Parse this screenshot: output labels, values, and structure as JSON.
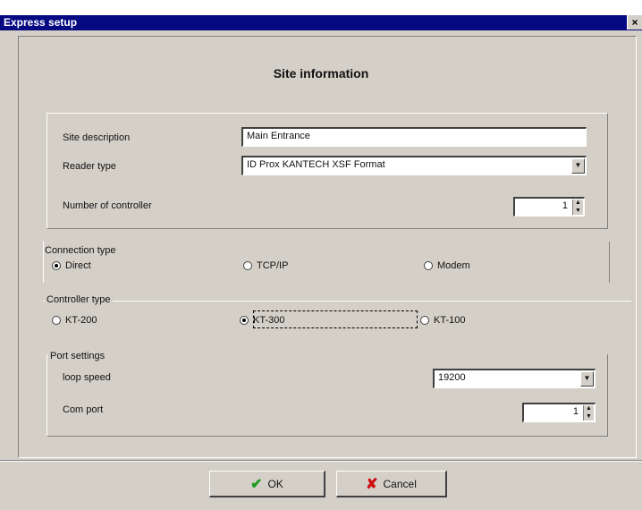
{
  "window": {
    "title": "Express setup",
    "close_glyph": "×"
  },
  "heading": "Site information",
  "site": {
    "description_label": "Site description",
    "description_value": "Main Entrance",
    "reader_label": "Reader type",
    "reader_value": "ID Prox KANTECH XSF Format",
    "controllers_label": "Number of controller",
    "controllers_value": "1"
  },
  "connection": {
    "legend": "Connection type",
    "options": [
      {
        "label": "Direct",
        "selected": true
      },
      {
        "label": "TCP/IP",
        "selected": false
      },
      {
        "label": "Modem",
        "selected": false
      }
    ]
  },
  "controller": {
    "legend": "Controller type",
    "options": [
      {
        "label": "KT-200",
        "selected": false
      },
      {
        "label": "KT-300",
        "selected": true
      },
      {
        "label": "KT-100",
        "selected": false
      }
    ]
  },
  "port": {
    "legend": "Port settings",
    "speed_label": "loop speed",
    "speed_value": "19200",
    "com_label": "Com port",
    "com_value": "1"
  },
  "buttons": {
    "ok_label": "OK",
    "ok_icon": "✔",
    "cancel_label": "Cancel",
    "cancel_icon": "✘"
  },
  "colors": {
    "titlebar": "#050a82",
    "dialog": "#d4d0c8",
    "ok_icon": "#1f9a1f",
    "cancel_icon": "#cc1010"
  }
}
